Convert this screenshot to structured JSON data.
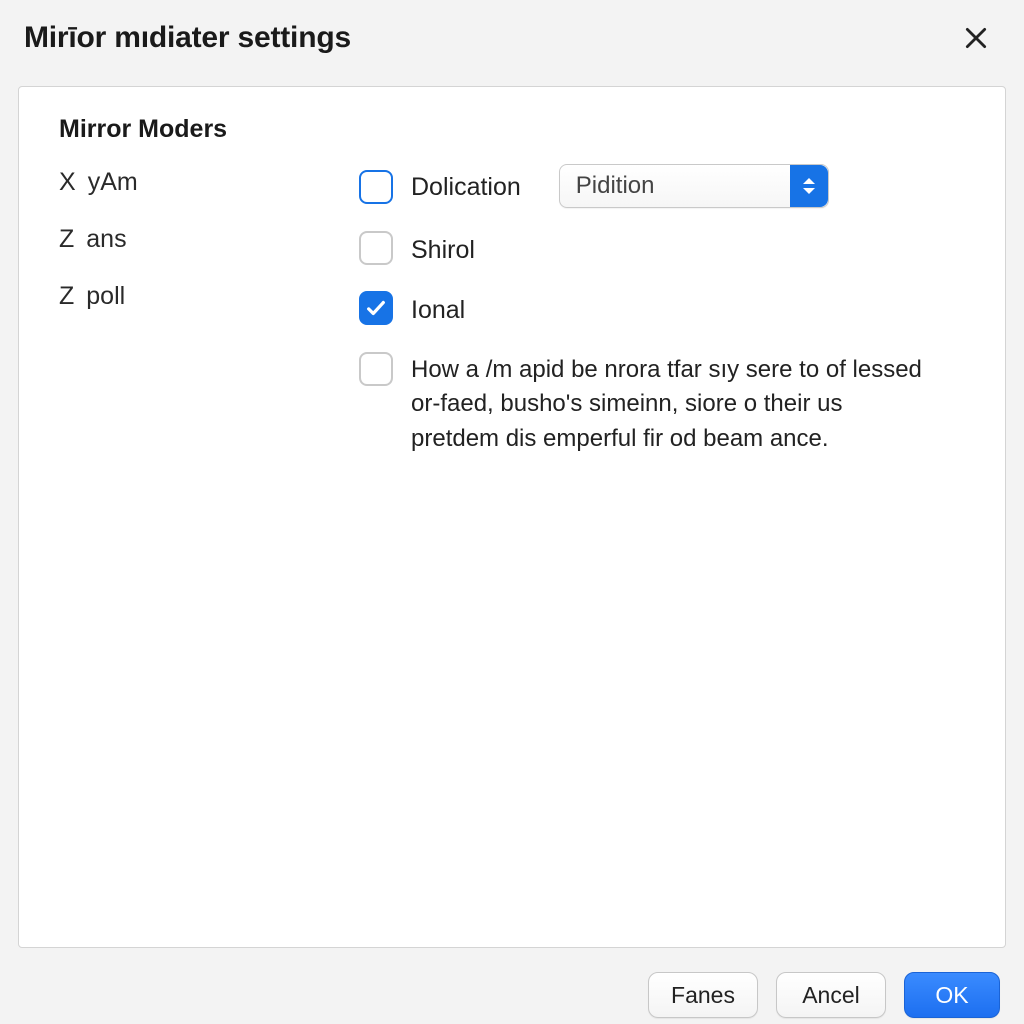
{
  "dialog": {
    "title": "Mirīor mıdiater settings"
  },
  "section": {
    "title": "Mirror Moders"
  },
  "axes": [
    {
      "letter": "X",
      "label": "yAm"
    },
    {
      "letter": "Z",
      "label": "ans"
    },
    {
      "letter": "Z",
      "label": "poll"
    }
  ],
  "options": {
    "dolication_label": "Dolication",
    "shirol_label": "Shirol",
    "ional_label": "Ional",
    "long_label": "How a /m apid be nrora tfar sıy sere to of lessed or-faed, busho's simeinn, siore o their us pretdem dis emperful fir od beam ance."
  },
  "select": {
    "value": "Pidition"
  },
  "buttons": {
    "fanes": "Fanes",
    "ancel": "Ancel",
    "ok": "OK"
  },
  "colors": {
    "accent": "#1773e6"
  }
}
